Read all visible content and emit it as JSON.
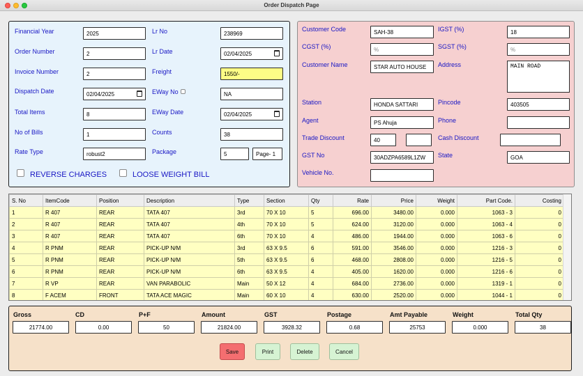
{
  "window": {
    "title": "Order Dispatch Page"
  },
  "left": {
    "financial_year": {
      "label": "Financial Year",
      "value": "2025"
    },
    "lr_no": {
      "label": "Lr No",
      "value": "238969"
    },
    "order_number": {
      "label": "Order Number",
      "value": "2"
    },
    "lr_date": {
      "label": "Lr Date",
      "value": "02/04/2025"
    },
    "invoice_number": {
      "label": "Invoice Number",
      "value": "2"
    },
    "freight": {
      "label": "Freight",
      "value": "1550/-"
    },
    "dispatch_date": {
      "label": "Dispatch Date",
      "value": "02/04/2025"
    },
    "eway_no": {
      "label": "EWay No",
      "value": "NA"
    },
    "total_items": {
      "label": "Total Items",
      "value": "8"
    },
    "eway_date": {
      "label": "EWay Date",
      "value": "02/04/2025"
    },
    "no_of_bills": {
      "label": "No of Bills",
      "value": "1"
    },
    "counts": {
      "label": "Counts",
      "value": "38"
    },
    "rate_type": {
      "label": "Rate Type",
      "value": "robust2"
    },
    "package": {
      "label": "Package",
      "value": "5",
      "page": "Page- 1"
    },
    "reverse_charges": "REVERSE CHARGES",
    "loose_weight_bill": "LOOSE WEIGHT BILL"
  },
  "right": {
    "customer_code": {
      "label": "Customer Code",
      "value": "SAH-38"
    },
    "igst": {
      "label": "IGST (%)",
      "value": "18"
    },
    "cgst": {
      "label": "CGST (%)",
      "placeholder": "%"
    },
    "sgst": {
      "label": "SGST (%)",
      "placeholder": "%"
    },
    "customer_name": {
      "label": "Customer Name",
      "value": "STAR AUTO HOUSE"
    },
    "address": {
      "label": "Address",
      "value": "MAIN ROAD"
    },
    "station": {
      "label": "Station",
      "value": "HONDA SATTARI"
    },
    "pincode": {
      "label": "Pincode",
      "value": "403505"
    },
    "agent": {
      "label": "Agent",
      "value": "PS Ahuja"
    },
    "phone": {
      "label": "Phone",
      "value": ""
    },
    "trade_discount": {
      "label": "Trade Discount",
      "value": "40",
      "value2": ""
    },
    "cash_discount": {
      "label": "Cash Discount",
      "value": ""
    },
    "gst_no": {
      "label": "GST No",
      "value": "30ADZPA6589L1ZW"
    },
    "state": {
      "label": "State",
      "value": "GOA"
    },
    "vehicle_no": {
      "label": "Vehicle No.",
      "value": ""
    }
  },
  "table": {
    "columns": [
      "S. No",
      "ItemCode",
      "Position",
      "Description",
      "Type",
      "Section",
      "Qty",
      "Rate",
      "Price",
      "Weight",
      "Part Code.",
      "Costing"
    ],
    "rows": [
      [
        "1",
        "R 407",
        "REAR",
        "TATA 407",
        "3rd",
        "70 X 10",
        "5",
        "696.00",
        "3480.00",
        "0.000",
        "1063 - 3",
        "0"
      ],
      [
        "2",
        "R 407",
        "REAR",
        "TATA 407",
        "4th",
        "70 X 10",
        "5",
        "624.00",
        "3120.00",
        "0.000",
        "1063 - 4",
        "0"
      ],
      [
        "3",
        "R 407",
        "REAR",
        "TATA 407",
        "6th",
        "70 X 10",
        "4",
        "486.00",
        "1944.00",
        "0.000",
        "1063 - 6",
        "0"
      ],
      [
        "4",
        "R PNM",
        "REAR",
        "PICK-UP N/M",
        "3rd",
        "63 X 9.5",
        "6",
        "591.00",
        "3546.00",
        "0.000",
        "1216 - 3",
        "0"
      ],
      [
        "5",
        "R PNM",
        "REAR",
        "PICK-UP N/M",
        "5th",
        "63 X 9.5",
        "6",
        "468.00",
        "2808.00",
        "0.000",
        "1216 - 5",
        "0"
      ],
      [
        "6",
        "R PNM",
        "REAR",
        "PICK-UP N/M",
        "6th",
        "63 X 9.5",
        "4",
        "405.00",
        "1620.00",
        "0.000",
        "1216 - 6",
        "0"
      ],
      [
        "7",
        "R VP",
        "REAR",
        "VAN PARABOLIC",
        "Main",
        "50 X 12",
        "4",
        "684.00",
        "2736.00",
        "0.000",
        "1319 - 1",
        "0"
      ],
      [
        "8",
        "F ACEM",
        "FRONT",
        "TATA ACE MAGIC",
        "Main",
        "60 X 10",
        "4",
        "630.00",
        "2520.00",
        "0.000",
        "1044 - 1",
        "0"
      ]
    ]
  },
  "totals": {
    "gross": {
      "label": "Gross",
      "value": "21774.00"
    },
    "cd": {
      "label": "CD",
      "value": "0.00"
    },
    "pf": {
      "label": "P+F",
      "value": "50"
    },
    "amount": {
      "label": "Amount",
      "value": "21824.00"
    },
    "gst": {
      "label": "GST",
      "value": "3928.32"
    },
    "postage": {
      "label": "Postage",
      "value": "0.68"
    },
    "amt_payable": {
      "label": "Amt Payable",
      "value": "25753"
    },
    "weight": {
      "label": "Weight",
      "value": "0.000"
    },
    "total_qty": {
      "label": "Total Qty",
      "value": "38"
    }
  },
  "buttons": {
    "save": "Save",
    "print": "Print",
    "delete": "Delete",
    "cancel": "Cancel"
  },
  "colors": {
    "label": "#1816c4",
    "left_panel": "#e7f3fc",
    "right_panel": "#f6d0d0",
    "bottom_panel": "#f6e1c9",
    "grid_row": "#ffffc2",
    "save": "#f46e70",
    "action": "#d6f3d3",
    "freight_highlight": "#fdfd86"
  }
}
